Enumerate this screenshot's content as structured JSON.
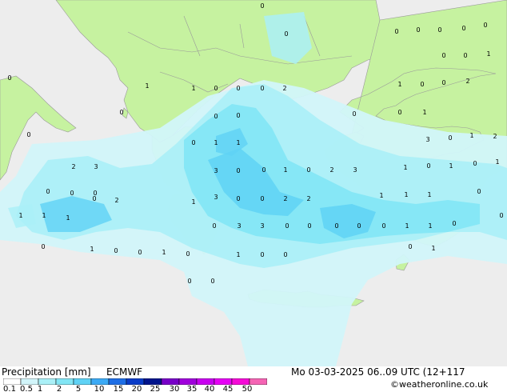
{
  "title": "Precipitation [mm]",
  "model": "ECMWF",
  "datetime": "Mo 03-03-2025 06..09 UTC (12+117",
  "credit": "©weatheronline.co.uk",
  "colors": {
    "sea": "#ededed",
    "land": "#c6f2a0",
    "border": "#999999"
  },
  "legend": {
    "ticks": [
      "0.1",
      "0.5",
      "1",
      "2",
      "5",
      "10",
      "15",
      "20",
      "25",
      "30",
      "35",
      "40",
      "45",
      "50"
    ],
    "colors": [
      "#ffffff",
      "#d2f5fa",
      "#aaf0f7",
      "#82e6f5",
      "#5fd2f5",
      "#3caaf5",
      "#1e6ee6",
      "#0a3cc8",
      "#00148c",
      "#7800c8",
      "#a000dc",
      "#c800f0",
      "#e600f5",
      "#f50ad7",
      "#f564b4"
    ]
  },
  "precip_values": [
    {
      "label": "0"
    },
    {
      "label": "0"
    },
    {
      "label": "0"
    },
    {
      "label": "0"
    },
    {
      "label": "0"
    },
    {
      "label": "0"
    },
    {
      "label": "0"
    },
    {
      "label": "0"
    },
    {
      "label": "0"
    },
    {
      "label": "1"
    },
    {
      "label": "0"
    },
    {
      "label": "1"
    },
    {
      "label": "1"
    },
    {
      "label": "0"
    },
    {
      "label": "0"
    },
    {
      "label": "0"
    },
    {
      "label": "2"
    },
    {
      "label": "1"
    },
    {
      "label": "0"
    },
    {
      "label": "0"
    },
    {
      "label": "2"
    },
    {
      "label": "0"
    },
    {
      "label": "0"
    },
    {
      "label": "0"
    },
    {
      "label": "0"
    },
    {
      "label": "0"
    },
    {
      "label": "1"
    },
    {
      "label": "0"
    },
    {
      "label": "3"
    },
    {
      "label": "0"
    },
    {
      "label": "1"
    },
    {
      "label": "2"
    },
    {
      "label": "0"
    },
    {
      "label": "1"
    },
    {
      "label": "1"
    },
    {
      "label": "2"
    },
    {
      "label": "3"
    },
    {
      "label": "0"
    },
    {
      "label": "1"
    },
    {
      "label": "0"
    },
    {
      "label": "2"
    },
    {
      "label": "3"
    },
    {
      "label": "1"
    },
    {
      "label": "0"
    },
    {
      "label": "1"
    },
    {
      "label": "0"
    },
    {
      "label": "1"
    },
    {
      "label": "3"
    },
    {
      "label": "0"
    },
    {
      "label": "0"
    },
    {
      "label": "0"
    },
    {
      "label": "0"
    },
    {
      "label": "3"
    },
    {
      "label": "0"
    },
    {
      "label": "0"
    },
    {
      "label": "2"
    },
    {
      "label": "2"
    },
    {
      "label": "1"
    },
    {
      "label": "1"
    },
    {
      "label": "1"
    },
    {
      "label": "0"
    },
    {
      "label": "1"
    },
    {
      "label": "1"
    },
    {
      "label": "1"
    },
    {
      "label": "0"
    },
    {
      "label": "2"
    },
    {
      "label": "1"
    },
    {
      "label": "0"
    },
    {
      "label": "3"
    },
    {
      "label": "3"
    },
    {
      "label": "0"
    },
    {
      "label": "0"
    },
    {
      "label": "0"
    },
    {
      "label": "0"
    },
    {
      "label": "0"
    },
    {
      "label": "1"
    },
    {
      "label": "1"
    },
    {
      "label": "0"
    },
    {
      "label": "0"
    },
    {
      "label": "0"
    },
    {
      "label": "1"
    },
    {
      "label": "0"
    },
    {
      "label": "0"
    },
    {
      "label": "1"
    },
    {
      "label": "0"
    },
    {
      "label": "1"
    },
    {
      "label": "0"
    },
    {
      "label": "0"
    },
    {
      "label": "0"
    },
    {
      "label": "1"
    },
    {
      "label": "0"
    },
    {
      "label": "0"
    }
  ]
}
